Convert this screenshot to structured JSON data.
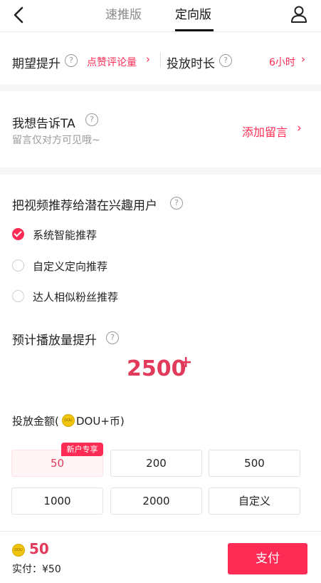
{
  "header": {
    "tabs": [
      {
        "label": "速推版",
        "active": false
      },
      {
        "label": "定向版",
        "active": true
      }
    ],
    "back_icon": "back-arrow-icon",
    "user_icon": "user-icon"
  },
  "goal": {
    "label": "期望提升",
    "value": "点赞评论量",
    "duration_label": "投放时长",
    "duration_value": "6小时"
  },
  "message": {
    "title": "我想告诉TA",
    "subtitle": "留言仅对方可见哦~",
    "action": "添加留言"
  },
  "recommend": {
    "title": "把视频推荐给潜在兴趣用户",
    "options": [
      {
        "label": "系统智能推荐",
        "selected": true
      },
      {
        "label": "自定义定向推荐",
        "selected": false
      },
      {
        "label": "达人相似粉丝推荐",
        "selected": false
      }
    ]
  },
  "estimate": {
    "title": "预计播放量提升",
    "value": "2500",
    "suffix": "+"
  },
  "amount": {
    "title_prefix": "投放金额(",
    "coin_text": "DOU",
    "title_suffix": "DOU+币)",
    "badge": "新户专享",
    "options": [
      "50",
      "200",
      "500",
      "1000",
      "2000",
      "自定义"
    ],
    "selected": "50"
  },
  "footer": {
    "coin_text": "DOU",
    "amount": "50",
    "paid": "实付：¥50",
    "pay_button": "支付"
  },
  "colors": {
    "accent": "#fe2c55",
    "value_pink": "#e23a5a"
  }
}
